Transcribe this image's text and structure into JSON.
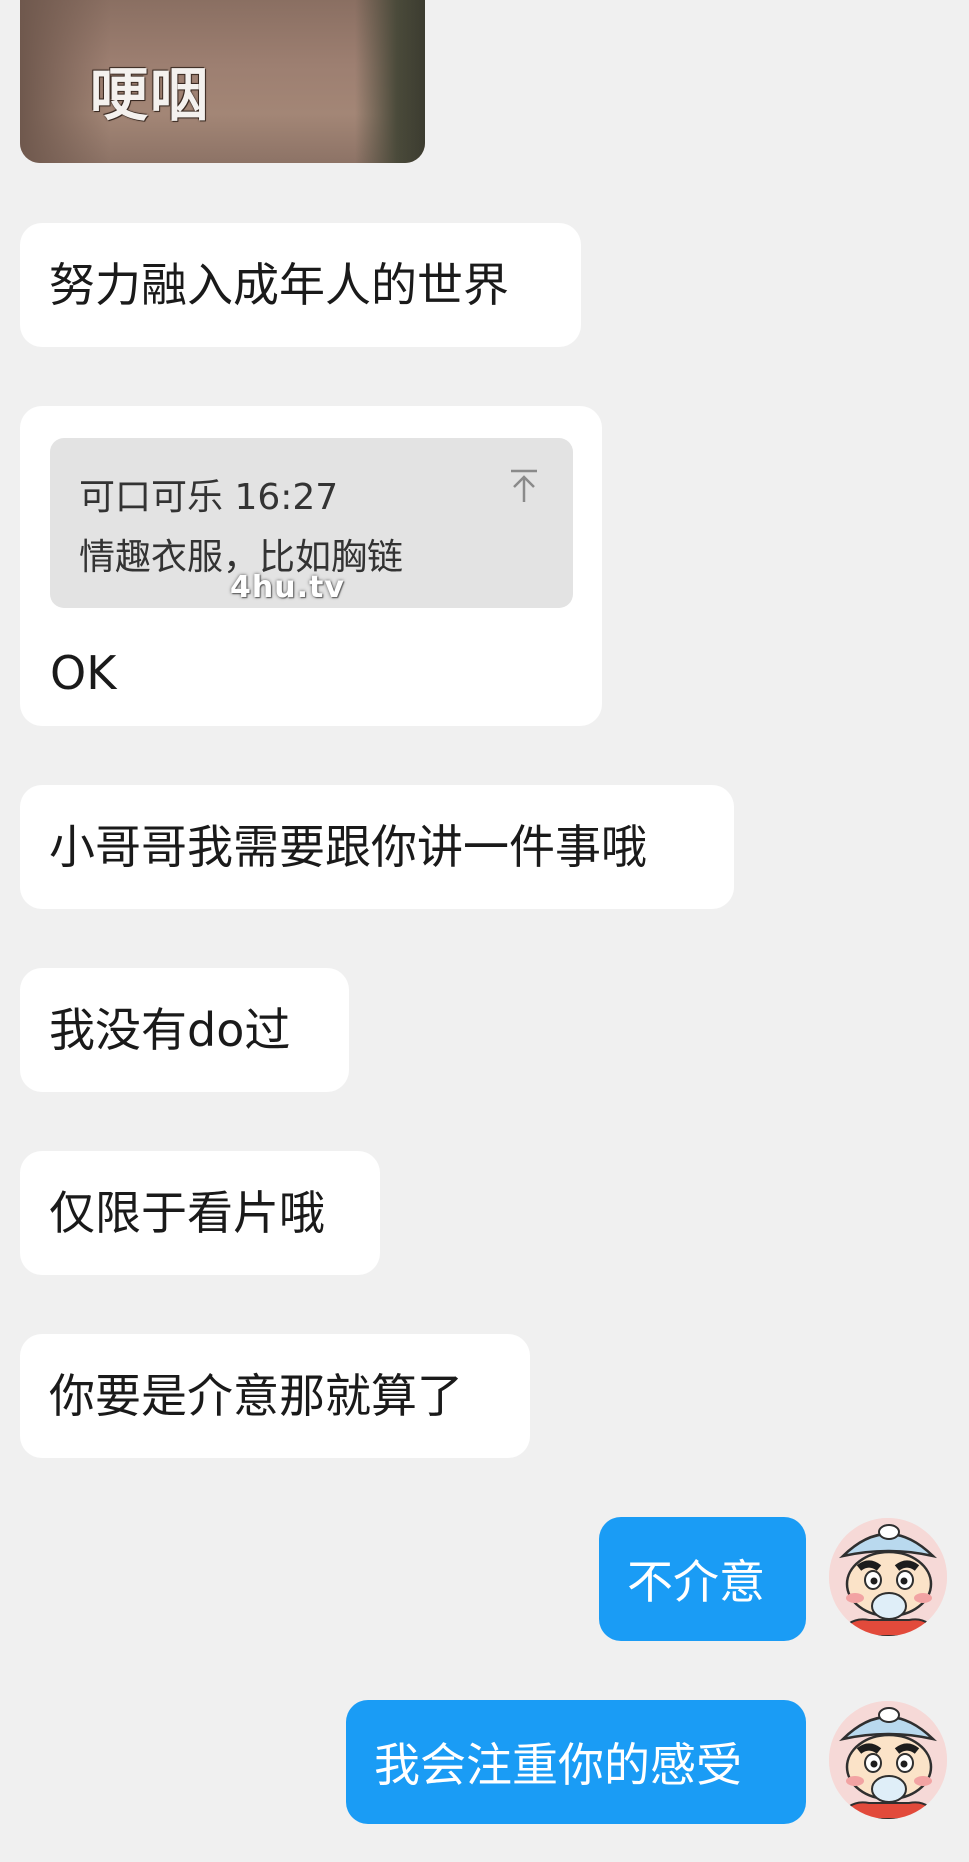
{
  "sticker": {
    "caption": "哽咽"
  },
  "messages": {
    "received": [
      "努力融入成年人的世界",
      "小哥哥我需要跟你讲一件事哦",
      "我没有do过",
      "仅限于看片哦",
      "你要是介意那就算了"
    ],
    "quote": {
      "sender_time": "可口可乐 16:27",
      "content": "情趣衣服，比如胸链",
      "reply": "OK"
    },
    "sent": [
      "不介意",
      "我会注重你的感受"
    ]
  },
  "watermark": "4hu.tv",
  "colors": {
    "background": "#f0f0f0",
    "received_bubble": "#ffffff",
    "sent_bubble": "#1a9cf5",
    "quote_card": "#e3e3e3"
  },
  "icons": {
    "quote_jump": "arrow-up-to-top-icon",
    "avatar": "cartoon-boy-avatar"
  }
}
